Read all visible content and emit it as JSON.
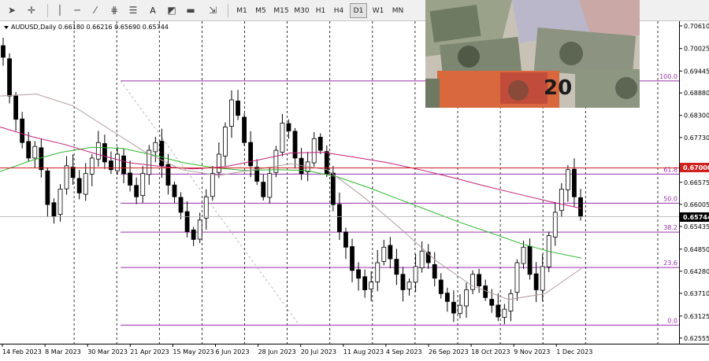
{
  "toolbar": {
    "timeframes": [
      "M1",
      "M5",
      "M15",
      "M30",
      "H1",
      "H4",
      "D1",
      "W1",
      "MN"
    ],
    "active_timeframe": "D1",
    "text_tool": "A"
  },
  "chart_data": {
    "type": "candlestick",
    "title": "AUDUSD,Daily  0.66180 0.66216 0.65690 0.65744",
    "symbol": "AUDUSD",
    "period": "Daily",
    "ohlc": {
      "open": 0.6618,
      "high": 0.66216,
      "low": 0.6569,
      "close": 0.65744
    },
    "price_axis": {
      "min": 0.6241,
      "max": 0.7073,
      "ticks": [
        0.7061,
        0.70025,
        0.69445,
        0.6888,
        0.683,
        0.6773,
        0.66575,
        0.66005,
        0.65435,
        0.6485,
        0.6428,
        0.6371,
        0.63125,
        0.62555
      ]
    },
    "date_labels": [
      "14 Feb 2023",
      "8 Mar 2023",
      "30 Mar 2023",
      "21 Apr 2023",
      "15 May 2023",
      "6 Jun 2023",
      "28 Jun 2023",
      "20 Jul 2023",
      "11 Aug 2023",
      "4 Sep 2023",
      "26 Sep 2023",
      "18 Oct 2023",
      "9 Nov 2023",
      "1 Dec 2023"
    ],
    "price_tags": {
      "current": "0.65744",
      "resistance": "0.67000"
    },
    "resistance_level": 0.67,
    "current_price": 0.65744,
    "fibonacci": {
      "levels": [
        {
          "label": "100.0",
          "price": 0.6919
        },
        {
          "label": "61.8",
          "price": 0.66785
        },
        {
          "label": "50.0",
          "price": 0.66035
        },
        {
          "label": "38.2",
          "price": 0.6529
        },
        {
          "label": "23.6",
          "price": 0.64375
        },
        {
          "label": "0.0",
          "price": 0.6289
        }
      ],
      "color": "#9b2fae"
    },
    "price_series": [
      0.698,
      0.688,
      0.682,
      0.676,
      0.672,
      0.675,
      0.669,
      0.66,
      0.657,
      0.664,
      0.67,
      0.667,
      0.663,
      0.668,
      0.672,
      0.676,
      0.671,
      0.669,
      0.673,
      0.668,
      0.665,
      0.662,
      0.668,
      0.674,
      0.676,
      0.67,
      0.665,
      0.662,
      0.658,
      0.653,
      0.651,
      0.656,
      0.662,
      0.668,
      0.673,
      0.68,
      0.687,
      0.683,
      0.676,
      0.67,
      0.666,
      0.662,
      0.668,
      0.674,
      0.681,
      0.679,
      0.672,
      0.668,
      0.671,
      0.677,
      0.674,
      0.668,
      0.66,
      0.653,
      0.649,
      0.643,
      0.641,
      0.638,
      0.64,
      0.645,
      0.649,
      0.646,
      0.642,
      0.638,
      0.64,
      0.644,
      0.648,
      0.645,
      0.641,
      0.637,
      0.635,
      0.632,
      0.634,
      0.638,
      0.642,
      0.639,
      0.636,
      0.634,
      0.631,
      0.633,
      0.637,
      0.645,
      0.649,
      0.642,
      0.638,
      0.644,
      0.652,
      0.658,
      0.664,
      0.669,
      0.662,
      0.657
    ],
    "ma_green": [
      0.6685,
      0.6713,
      0.6735,
      0.6748,
      0.6745,
      0.6728,
      0.6708,
      0.6695,
      0.6688,
      0.669,
      0.6688,
      0.6672,
      0.6645,
      0.6615,
      0.6585,
      0.6555,
      0.6528,
      0.65,
      0.6478,
      0.6462
    ],
    "ma_purple": [
      0.68,
      0.6775,
      0.6755,
      0.673,
      0.6708,
      0.6698,
      0.6692,
      0.6698,
      0.6715,
      0.6733,
      0.6735,
      0.6722,
      0.6708,
      0.669,
      0.667,
      0.6648,
      0.6628,
      0.6608,
      0.659
    ],
    "ma_gray": [
      0.688,
      0.6885,
      0.6855,
      0.6795,
      0.6735,
      0.669,
      0.6675,
      0.669,
      0.6705,
      0.669,
      0.662,
      0.654,
      0.6455,
      0.639,
      0.6355,
      0.637,
      0.6435
    ]
  },
  "colors": {
    "background": "#ffffff",
    "candle": "#000000",
    "fib": "#9b2fae",
    "resistance": "#d02020",
    "ma_green": "#2eb82e",
    "ma_purple": "#c0207a",
    "ma_gray": "#b39c9c"
  }
}
